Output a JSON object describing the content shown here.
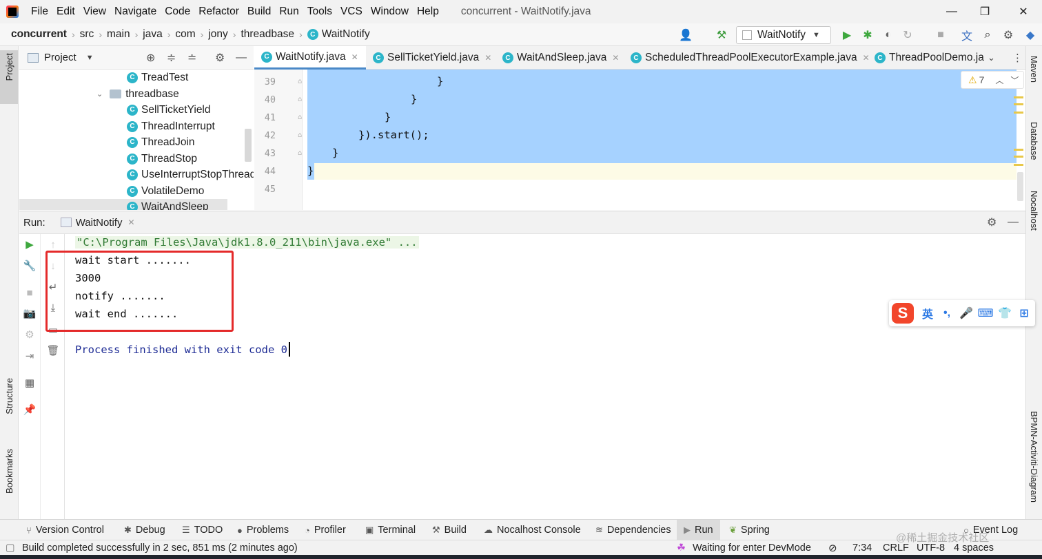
{
  "menu": {
    "items": [
      "File",
      "Edit",
      "View",
      "Navigate",
      "Code",
      "Refactor",
      "Build",
      "Run",
      "Tools",
      "VCS",
      "Window",
      "Help"
    ],
    "window_title": "concurrent - WaitNotify.java"
  },
  "breadcrumb": [
    "concurrent",
    "src",
    "main",
    "java",
    "com",
    "jony",
    "threadbase",
    "WaitNotify"
  ],
  "run_config": {
    "label": "WaitNotify"
  },
  "project_panel": {
    "title": "Project",
    "tree": [
      {
        "label": "TreadTest",
        "kind": "class"
      },
      {
        "label": "threadbase",
        "kind": "folder"
      },
      {
        "label": "SellTicketYield",
        "kind": "class"
      },
      {
        "label": "ThreadInterrupt",
        "kind": "class"
      },
      {
        "label": "ThreadJoin",
        "kind": "class"
      },
      {
        "label": "ThreadStop",
        "kind": "class"
      },
      {
        "label": "UseInterruptStopThread",
        "kind": "class"
      },
      {
        "label": "VolatileDemo",
        "kind": "class"
      },
      {
        "label": "WaitAndSleep",
        "kind": "class"
      }
    ]
  },
  "editor": {
    "tabs": [
      "WaitNotify.java",
      "SellTicketYield.java",
      "WaitAndSleep.java",
      "ScheduledThreadPoolExecutorExample.java",
      "ThreadPoolDemo.ja"
    ],
    "active_tab": "WaitNotify.java",
    "line_numbers": [
      "39",
      "40",
      "41",
      "42",
      "43",
      "44",
      "45"
    ],
    "code_lines": [
      "}",
      "}",
      "}",
      "}).start();",
      "}",
      "}",
      ""
    ],
    "warnings_count": "7"
  },
  "run_panel": {
    "label": "Run:",
    "tab": "WaitNotify",
    "command": "\"C:\\Program Files\\Java\\jdk1.8.0_211\\bin\\java.exe\" ...",
    "output": [
      "wait start .......",
      "3000",
      "notify .......",
      "wait end ......."
    ],
    "exit_message": "Process finished with exit code 0"
  },
  "left_strip": {
    "project": "Project",
    "structure": "Structure",
    "bookmarks": "Bookmarks"
  },
  "right_strip": {
    "maven": "Maven",
    "database": "Database",
    "nocalhost": "Nocalhost",
    "bpmn": "BPMN-Activiti-Diagram"
  },
  "ime_bar": {
    "logo": "S",
    "mode": "英",
    "punct": "•,",
    "mic": "🎤",
    "keyboard": "⌨",
    "shirt": "👕",
    "grid": "⊞"
  },
  "tool_tabs": [
    "Version Control",
    "Debug",
    "TODO",
    "Problems",
    "Profiler",
    "Terminal",
    "Build",
    "Nocalhost Console",
    "Dependencies",
    "Run",
    "Spring"
  ],
  "event_log": "Event Log",
  "status": {
    "message": "Build completed successfully in 2 sec, 851 ms (2 minutes ago)",
    "devmode": "Waiting for enter DevMode",
    "position": "7:34",
    "line_sep": "CRLF",
    "encoding": "UTF-8",
    "indent": "4 spaces",
    "watermark": "@稀土掘金技术社区"
  },
  "colors": {
    "selection": "#a6d2ff",
    "highlight_box": "#e42a2a",
    "accent": "#4a88c7",
    "run_green": "#3ea83e"
  }
}
